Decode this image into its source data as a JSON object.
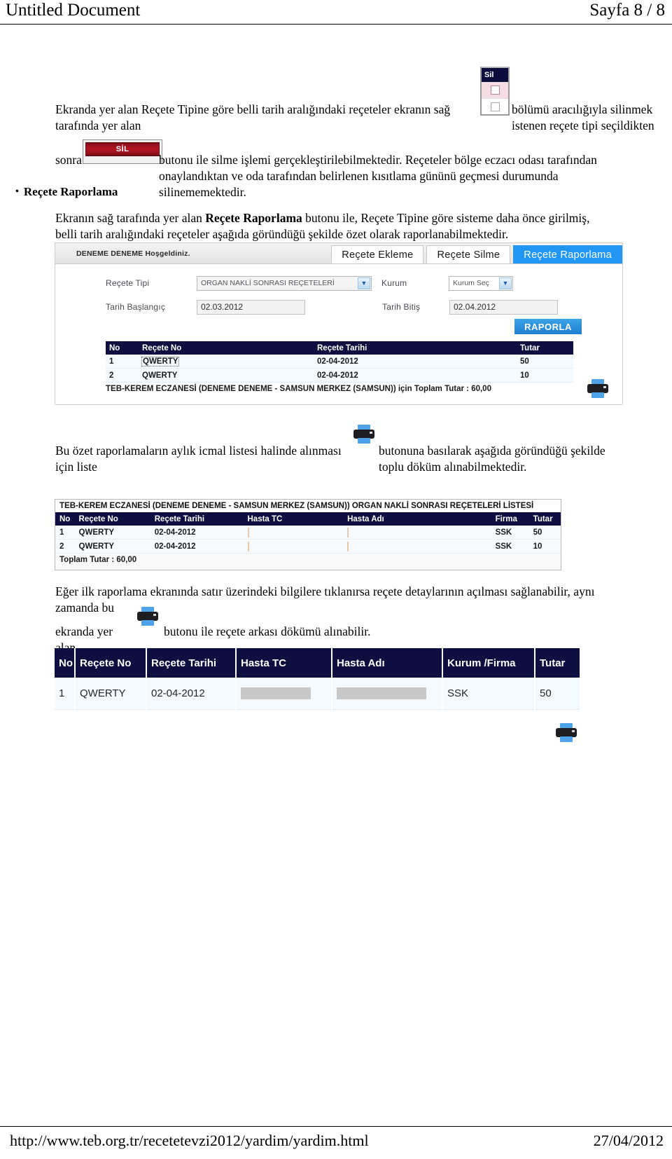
{
  "page": {
    "header_title": "Untitled Document",
    "header_page": "Sayfa 8 / 8",
    "footer_url": "http://www.teb.org.tr/recetetevzi2012/yardim/yardim.html",
    "footer_date": "27/04/2012"
  },
  "colors": {
    "accent_blue": "#2196f3",
    "table_header_navy": "#0e0e40",
    "delete_button_red": "#b3141f",
    "redact_peach": "#fbdfc8",
    "redact_grey": "#c8c8c8"
  },
  "paragraphs": {
    "p1_before": "Ekranda yer alan Reçete Tipine göre belli tarih aralığındaki reçeteler ekranın sağ tarafında yer alan",
    "p1_after": "bölümü aracılığıyla silinmek istenen reçete tipi seçildikten",
    "p2_before": "sonra",
    "p2_after": "butonu ile silme işlemi gerçekleştirilebilmektedir. Reçeteler bölge eczacı odası tarafından onaylandıktan ve oda tarafından belirlenen kısıtlama gününü geçmesi durumunda silinememektedir.",
    "bullet_title": "Reçete Raporlama",
    "p3_a": "Ekranın sağ tarafında yer alan ",
    "p3_bold": "Reçete Raporlama",
    "p3_b": " butonu ile, Reçete Tipine göre sisteme daha önce girilmiş, belli tarih aralığındaki reçeteler aşağıda göründüğü şekilde özet olarak raporlanabilmektedir.",
    "p4_before": "Bu özet raporlamaların aylık icmal listesi halinde alınması için liste",
    "p4_after": "butonuna basılarak aşağıda göründüğü şekilde toplu döküm alınabilmektedir.",
    "p5_line1": "Eğer ilk raporlama ekranında satır üzerindeki bilgilere tıklanırsa reçete detaylarının açılması sağlanabilir, aynı zamanda bu",
    "p5_before": "ekranda yer alan",
    "p5_after": "butonu ile reçete arkası dökümü alınabilir."
  },
  "sil_widget": {
    "header_label": "Sil",
    "rows": [
      {
        "checked": false,
        "style": "pink"
      },
      {
        "checked": false,
        "style": "white"
      }
    ]
  },
  "sil_button": {
    "label": "SİL"
  },
  "report_form": {
    "welcome": "DENEME DENEME  Hoşgeldiniz.",
    "tabs": [
      {
        "label": "Reçete Ekleme",
        "active": false
      },
      {
        "label": "Reçete Silme",
        "active": false
      },
      {
        "label": "Reçete Raporlama",
        "active": true
      }
    ],
    "fields": {
      "recete_tipi_label": "Reçete Tipi",
      "recete_tipi_value": "ORGAN NAKLİ SONRASI REÇETELERİ",
      "kurum_label": "Kurum",
      "kurum_value": "Kurum Seç",
      "tarih_baslangic_label": "Tarih Başlangıç",
      "tarih_baslangic_value": "02.03.2012",
      "tarih_bitis_label": "Tarih Bitiş",
      "tarih_bitis_value": "02.04.2012"
    },
    "raporla_button": "RAPORLA",
    "table": {
      "columns": [
        "No",
        "Reçete No",
        "Reçete Tarihi",
        "Tutar"
      ],
      "rows": [
        {
          "no": "1",
          "recete_no": "QWERTY",
          "tarih": "02-04-2012",
          "tutar": "50"
        },
        {
          "no": "2",
          "recete_no": "QWERTY",
          "tarih": "02-04-2012",
          "tutar": "10"
        }
      ],
      "total_text": "TEB-KEREM ECZANESİ (DENEME DENEME - SAMSUN MERKEZ (SAMSUN)) için Toplam Tutar : 60,00"
    }
  },
  "list_table": {
    "title": "TEB-KEREM ECZANESİ (DENEME DENEME - SAMSUN MERKEZ (SAMSUN)) ORGAN NAKLİ SONRASI REÇETELERİ LİSTESİ",
    "columns": [
      "No",
      "Reçete No",
      "Reçete Tarihi",
      "Hasta TC",
      "Hasta Adı",
      "Firma",
      "Tutar"
    ],
    "rows": [
      {
        "no": "1",
        "recete_no": "QWERTY",
        "tarih": "02-04-2012",
        "hasta_tc": "",
        "hasta_adi": "",
        "firma": "SSK",
        "tutar": "50"
      },
      {
        "no": "2",
        "recete_no": "QWERTY",
        "tarih": "02-04-2012",
        "hasta_tc": "",
        "hasta_adi": "",
        "firma": "SSK",
        "tutar": "10"
      }
    ],
    "total_text": "Toplam Tutar : 60,00"
  },
  "detail_table": {
    "columns": [
      "No",
      "Reçete No",
      "Reçete Tarihi",
      "Hasta TC",
      "Hasta Adı",
      "Kurum /Firma",
      "Tutar"
    ],
    "rows": [
      {
        "no": "1",
        "recete_no": "QWERTY",
        "tarih": "02-04-2012",
        "hasta_tc": "",
        "hasta_adi": "",
        "firma": "SSK",
        "tutar": "50"
      }
    ]
  }
}
